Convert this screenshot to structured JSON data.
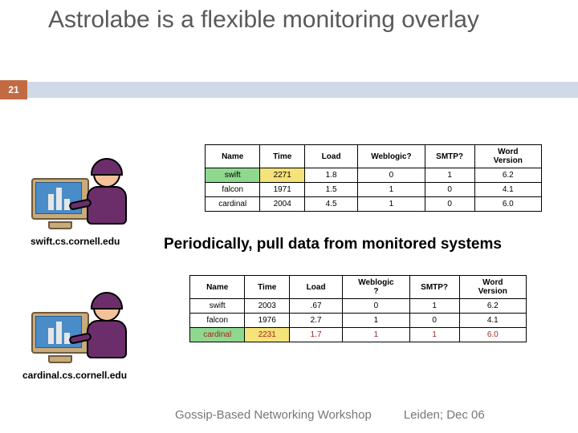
{
  "page_number": "21",
  "title": "Astrolabe is a flexible monitoring overlay",
  "caption1": "swift.cs.cornell.edu",
  "caption2": "cardinal.cs.cornell.edu",
  "midtext": "Periodically, pull data from monitored systems",
  "headers": {
    "name": "Name",
    "time": "Time",
    "load": "Load",
    "weblogic": "Weblogic?",
    "weblogic2": "Weblogic\n?",
    "smtp": "SMTP?",
    "word": "Word\nVersion"
  },
  "table1": {
    "rows": [
      {
        "name": "swift",
        "time": "2271",
        "load": "1.8",
        "weblogic": "0",
        "smtp": "1",
        "word": "6.2"
      },
      {
        "name": "falcon",
        "time": "1971",
        "load": "1.5",
        "weblogic": "1",
        "smtp": "0",
        "word": "4.1"
      },
      {
        "name": "cardinal",
        "time": "2004",
        "load": "4.5",
        "weblogic": "1",
        "smtp": "0",
        "word": "6.0"
      }
    ]
  },
  "table2": {
    "rows": [
      {
        "name": "swift",
        "time": "2003",
        "load": ".67",
        "weblogic": "0",
        "smtp": "1",
        "word": "6.2"
      },
      {
        "name": "falcon",
        "time": "1976",
        "load": "2.7",
        "weblogic": "1",
        "smtp": "0",
        "word": "4.1"
      },
      {
        "name": "cardinal",
        "time": "2231",
        "load": "1.7",
        "weblogic": "1",
        "smtp": "1",
        "word": "6.0"
      }
    ]
  },
  "footer": {
    "left": "Gossip-Based Networking Workshop",
    "right": "Leiden; Dec 06"
  }
}
